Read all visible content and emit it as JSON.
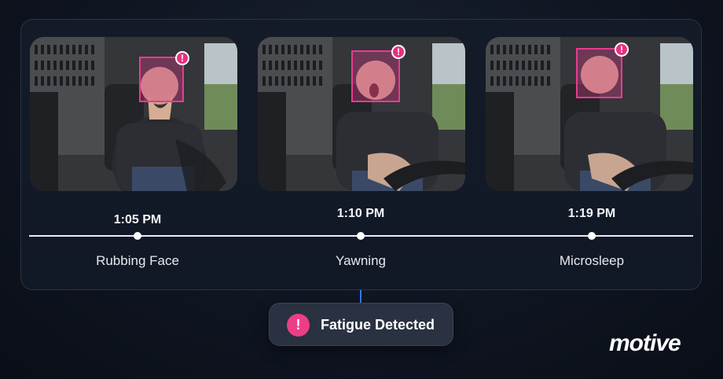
{
  "frames": [
    {
      "alert_icon": "exclamation-icon",
      "alert_glyph": "!"
    },
    {
      "alert_icon": "exclamation-icon",
      "alert_glyph": "!"
    },
    {
      "alert_icon": "exclamation-icon",
      "alert_glyph": "!"
    }
  ],
  "timeline": {
    "events": [
      {
        "time": "1:05 PM",
        "label": "Rubbing Face"
      },
      {
        "time": "1:10 PM",
        "label": "Yawning"
      },
      {
        "time": "1:19 PM",
        "label": "Microsleep"
      }
    ]
  },
  "status": {
    "icon": "exclamation-icon",
    "glyph": "!",
    "label": "Fatigue Detected"
  },
  "brand": {
    "logo_text": "motive"
  },
  "colors": {
    "accent": "#e83c8e",
    "connector": "#2f7ff0",
    "background": "#0f1521"
  }
}
